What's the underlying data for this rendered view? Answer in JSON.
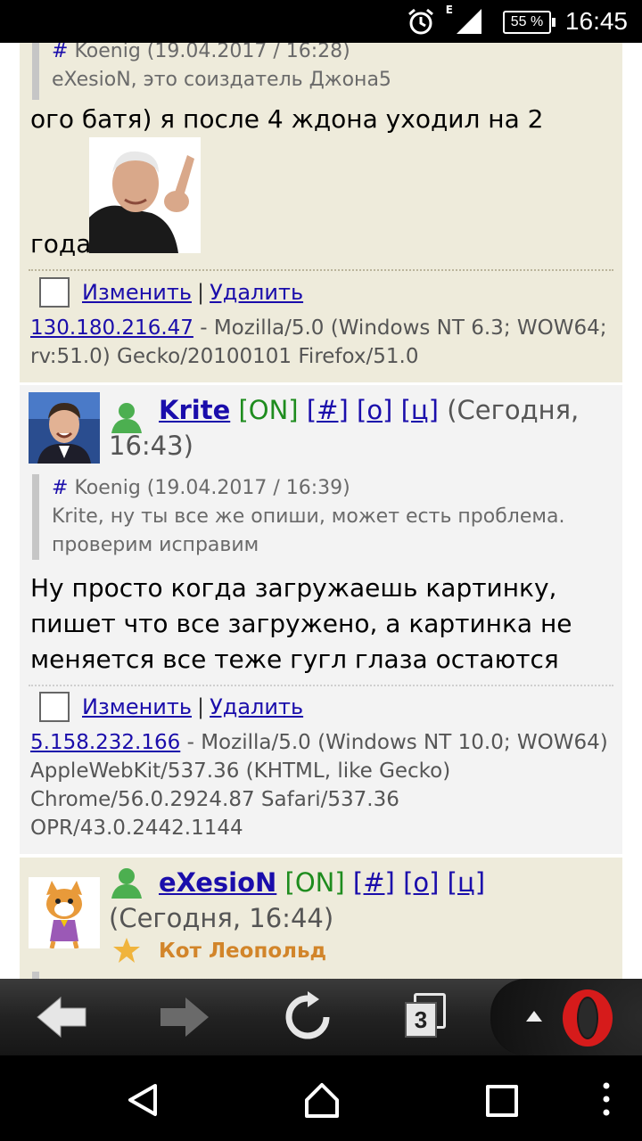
{
  "status": {
    "alarm_icon": "alarm-icon",
    "network": "E",
    "battery": "55 %",
    "time": "16:45"
  },
  "posts": [
    {
      "quote": {
        "hash": "#",
        "author_time": "Koenig (19.04.2017 / 16:28)",
        "text": "eXesioN, это соиздатель Джона5"
      },
      "message_line1": "ого батя) я после 4 ждона уходил на 2",
      "message_line2": "года",
      "actions": {
        "edit": "Изменить",
        "sep": "|",
        "delete": "Удалить"
      },
      "ip": "130.180.216.47",
      "ua": "- Mozilla/5.0 (Windows NT 6.3; WOW64; rv:51.0) Gecko/20100101 Firefox/51.0"
    },
    {
      "nick": "Krite",
      "status": "[ON]",
      "link_hash": "[#]",
      "link_o": "[o]",
      "link_c": "[ц]",
      "time": "(Сегодня, 16:43)",
      "quote": {
        "hash": "#",
        "author_time": "Koenig (19.04.2017 / 16:39)",
        "text": "Krite, ну ты все же опиши, может есть проблема. проверим исправим"
      },
      "message": "Ну просто когда загружаешь картинку, пишет что все загружено, а картинка не меняется все теже гугл глаза остаются",
      "actions": {
        "edit": "Изменить",
        "sep": "|",
        "delete": "Удалить"
      },
      "ip": "5.158.232.166",
      "ua": "- Mozilla/5.0 (Windows NT 10.0; WOW64) AppleWebKit/537.36 (KHTML, like Gecko) Chrome/56.0.2924.87 Safari/537.36 OPR/43.0.2442.1144"
    },
    {
      "nick": "eXesioN",
      "status": "[ON]",
      "link_hash": "[#]",
      "link_o": "[o]",
      "link_c": "[ц]",
      "time": "(Сегодня, 16:44)",
      "title": "Кот Леопольд"
    }
  ],
  "browser": {
    "back": "back-arrow-icon",
    "forward": "forward-arrow-icon",
    "reload": "reload-icon",
    "tabs_count": "3"
  },
  "colors": {
    "beige": "#eeebdb",
    "grey": "#f3f3f3",
    "link": "#1a0dab",
    "online": "#1e8c1e",
    "title": "#d2852a"
  }
}
